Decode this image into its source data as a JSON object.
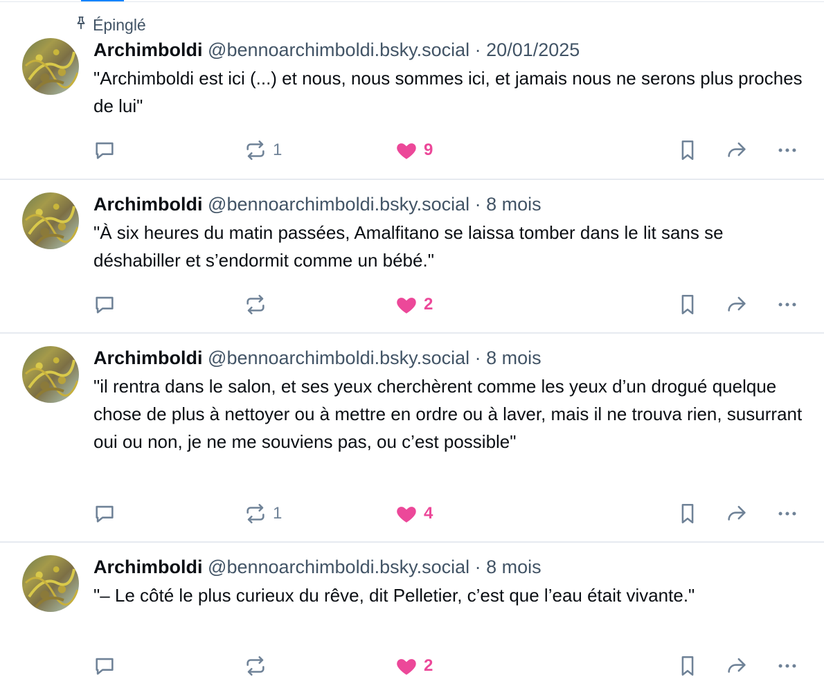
{
  "pinned_label": "Épinglé",
  "posts": [
    {
      "author": "Archimboldi",
      "handle": "@bennoarchimboldi.bsky.social",
      "separator": "·",
      "time": "20/01/2025",
      "text": "\"Archimboldi est ici (...) et nous, nous sommes ici, et jamais nous ne serons plus proches de lui\"",
      "reposts": "1",
      "likes": "9"
    },
    {
      "author": "Archimboldi",
      "handle": "@bennoarchimboldi.bsky.social",
      "separator": "·",
      "time": "8 mois",
      "text": "\"À six heures du matin passées, Amalfitano se laissa tomber dans le lit sans se déshabiller et s’endormit comme un bébé.\"",
      "reposts": "",
      "likes": "2"
    },
    {
      "author": "Archimboldi",
      "handle": "@bennoarchimboldi.bsky.social",
      "separator": "·",
      "time": "8 mois",
      "text": "\"il rentra dans le salon, et ses yeux cherchèrent comme les yeux d’un drogué quelque chose de plus à nettoyer ou à mettre en ordre ou à laver, mais il ne trouva rien, susurrant oui ou non, je ne me souviens pas, ou c’est possible\"",
      "reposts": "1",
      "likes": "4"
    },
    {
      "author": "Archimboldi",
      "handle": "@bennoarchimboldi.bsky.social",
      "separator": "·",
      "time": "8 mois",
      "text": "\"– Le côté le plus curieux du rêve, dit Pelletier, c’est que l’eau était vivante.\"",
      "reposts": "",
      "likes": "2"
    }
  ],
  "icons": {
    "pin": "pin-icon",
    "reply": "reply-icon",
    "repost": "repost-icon",
    "like": "heart-icon",
    "bookmark": "bookmark-icon",
    "share": "share-icon",
    "more": "more-icon"
  },
  "colors": {
    "accent": "#1083fe",
    "like": "#ec4899",
    "muted": "#6f8297",
    "handle": "#425466"
  }
}
